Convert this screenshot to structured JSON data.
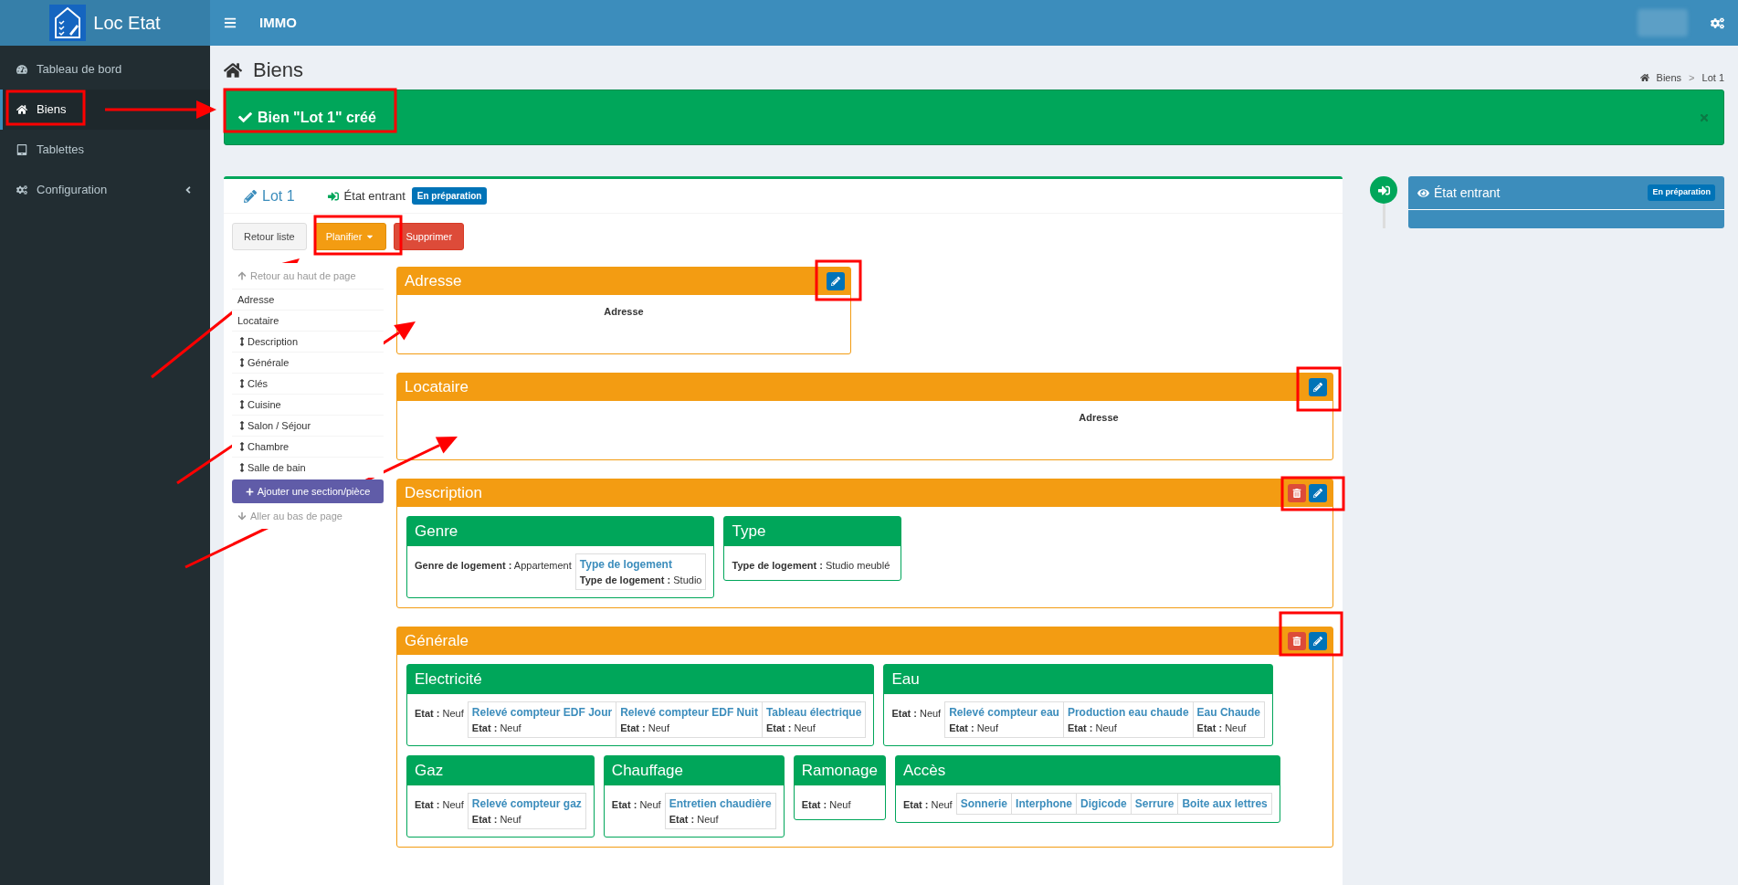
{
  "app": {
    "logo": "Loc Etat",
    "header_title": "IMMO"
  },
  "sidebar": {
    "items": [
      {
        "label": "Tableau de bord",
        "selected": false,
        "submenu": false
      },
      {
        "label": "Biens",
        "selected": true,
        "submenu": false
      },
      {
        "label": "Tablettes",
        "selected": false,
        "submenu": false
      },
      {
        "label": "Configuration",
        "selected": false,
        "submenu": true
      }
    ]
  },
  "page": {
    "title": "Biens",
    "breadcrumb": [
      "Biens",
      "Lot 1"
    ],
    "breadcrumb_separator": ">"
  },
  "alert": {
    "message": "Bien \"Lot 1\" créé"
  },
  "lot": {
    "title": "Lot 1",
    "state": "État entrant",
    "badge": "En préparation"
  },
  "actions": [
    {
      "label": "Retour liste",
      "kind": "default",
      "dropdown": false
    },
    {
      "label": "Planifier",
      "kind": "warning",
      "dropdown": true
    },
    {
      "label": "Supprimer",
      "kind": "danger",
      "dropdown": false
    }
  ],
  "nav": {
    "top": "Retour au haut de page",
    "items": [
      {
        "label": "Adresse",
        "draggable": false
      },
      {
        "label": "Locataire",
        "draggable": false
      },
      {
        "label": "Description",
        "draggable": true
      },
      {
        "label": "Générale",
        "draggable": true
      },
      {
        "label": "Clés",
        "draggable": true
      },
      {
        "label": "Cuisine",
        "draggable": true
      },
      {
        "label": "Salon / Séjour",
        "draggable": true
      },
      {
        "label": "Chambre",
        "draggable": true
      },
      {
        "label": "Salle de bain",
        "draggable": true
      }
    ],
    "add_button": "Ajouter une section/pièce",
    "bottom": "Aller au bas de page"
  },
  "sections": [
    {
      "title": "Adresse",
      "kind": "narrow",
      "deletable": false,
      "text": "Adresse"
    },
    {
      "title": "Locataire",
      "kind": "split",
      "deletable": false,
      "text": "Adresse"
    },
    {
      "title": "Description",
      "kind": "groups",
      "deletable": true,
      "groups": [
        {
          "title": "Genre",
          "summary": {
            "label": "Genre de logement :",
            "value": "Appartement"
          },
          "items": [
            {
              "title": "Type de logement",
              "label": "Type de logement :",
              "value": "Studio"
            }
          ]
        },
        {
          "title": "Type",
          "summary": {
            "label": "Type de logement :",
            "value": "Studio meublé"
          }
        }
      ]
    },
    {
      "title": "Générale",
      "kind": "groups",
      "deletable": true,
      "groups": [
        {
          "title": "Electricité",
          "summary": {
            "label": "Etat :",
            "value": "Neuf"
          },
          "items": [
            {
              "title": "Relevé compteur EDF Jour",
              "label": "Etat :",
              "value": "Neuf"
            },
            {
              "title": "Relevé compteur EDF Nuit",
              "label": "Etat :",
              "value": "Neuf"
            },
            {
              "title": "Tableau électrique",
              "label": "Etat :",
              "value": "Neuf"
            }
          ]
        },
        {
          "title": "Eau",
          "summary": {
            "label": "Etat :",
            "value": "Neuf"
          },
          "items": [
            {
              "title": "Relevé compteur eau",
              "label": "Etat :",
              "value": "Neuf"
            },
            {
              "title": "Production eau chaude",
              "label": "Etat :",
              "value": "Neuf"
            },
            {
              "title": "Eau Chaude",
              "label": "Etat :",
              "value": "Neuf"
            }
          ]
        },
        {
          "title": "Gaz",
          "summary": {
            "label": "Etat :",
            "value": "Neuf"
          },
          "items": [
            {
              "title": "Relevé compteur gaz",
              "label": "Etat :",
              "value": "Neuf"
            }
          ]
        },
        {
          "title": "Chauffage",
          "summary": {
            "label": "Etat :",
            "value": "Neuf"
          },
          "items": [
            {
              "title": "Entretien chaudière",
              "label": "Etat :",
              "value": "Neuf"
            }
          ]
        },
        {
          "title": "Ramonage",
          "summary": {
            "label": "Etat :",
            "value": "Neuf"
          }
        },
        {
          "title": "Accès",
          "summary": {
            "label": "Etat :",
            "value": "Neuf"
          },
          "items": [
            {
              "title": "Sonnerie"
            },
            {
              "title": "Interphone"
            },
            {
              "title": "Digicode"
            },
            {
              "title": "Serrure"
            },
            {
              "title": "Boite aux lettres"
            }
          ]
        }
      ]
    }
  ],
  "timeline": {
    "state": "État entrant",
    "badge": "En préparation"
  }
}
